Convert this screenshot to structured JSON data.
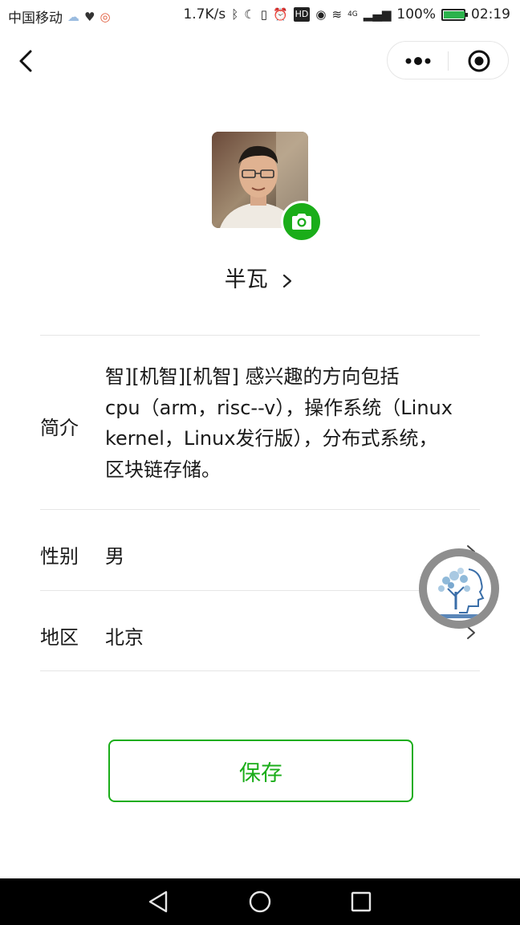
{
  "status_bar": {
    "carrier": "中国移动",
    "net_speed": "1.7K/s",
    "network_type": "4G",
    "battery": "100%",
    "battery_level": 1.0,
    "time": "02:19"
  },
  "profile": {
    "name": "半瓦"
  },
  "fields": {
    "bio_label": "简介",
    "bio_lines": [
      "智][机智][机智] 感兴趣的方向包括",
      "cpu（arm，risc--v），操作系统（Linux",
      "kernel，Linux发行版），分布式系统，",
      "区块链存储。"
    ],
    "gender_label": "性别",
    "gender_value": "男",
    "region_label": "地区",
    "region_value": "北京"
  },
  "save_label": "保存",
  "colors": {
    "accent": "#1aad19",
    "divider": "#e6e6e6",
    "nav_bar": "#000000"
  },
  "icons": {
    "back": "chevron-left-icon",
    "more": "more-dots-icon",
    "close": "target-close-icon",
    "camera": "camera-icon"
  }
}
